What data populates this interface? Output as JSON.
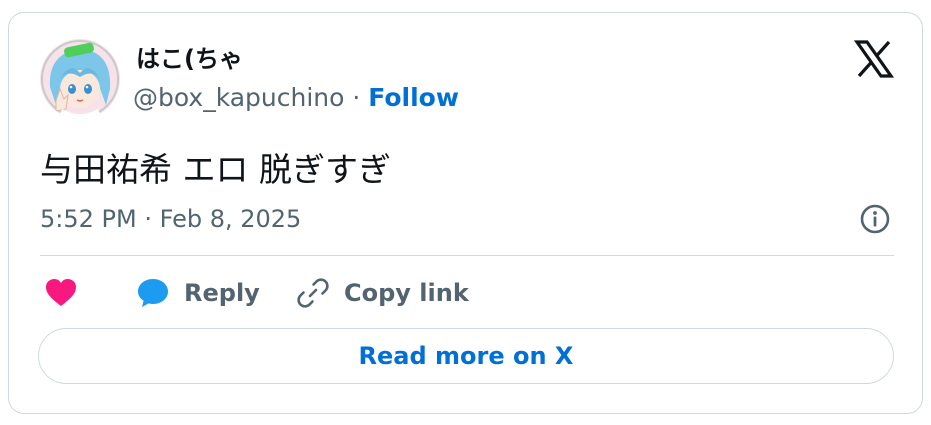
{
  "author": {
    "display_name": "はこ(ちゃ",
    "handle": "@box_kapuchino",
    "separator": " · ",
    "follow_label": "Follow"
  },
  "tweet": {
    "text": "与田祐希 エロ 脱ぎすぎ",
    "timestamp": "5:52 PM · Feb 8, 2025"
  },
  "actions": {
    "reply_label": "Reply",
    "copy_label": "Copy link"
  },
  "read_more_label": "Read more on X",
  "icons": {
    "brand": "x-logo-icon",
    "info": "info-icon",
    "like": "heart-icon",
    "reply": "speech-bubble-icon",
    "copy": "link-icon"
  },
  "colors": {
    "link": "#006fd6",
    "like": "#f91880",
    "reply": "#1d9bf0",
    "muted": "#536471",
    "text": "#0f1419",
    "border": "#cfd9de"
  }
}
